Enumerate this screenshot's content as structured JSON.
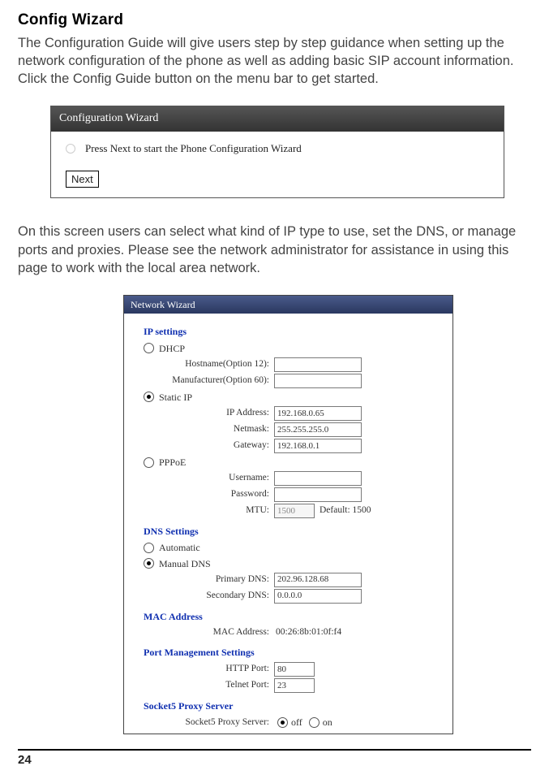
{
  "title": "Config Wizard",
  "intro": "The Configuration Guide will give users step by step guidance when setting up the network configuration of the phone as well as adding basic SIP account information.  Click the Config Guide button on the menu bar to get started.",
  "win1": {
    "title": "Configuration Wizard",
    "prompt": "Press Next to start the Phone Configuration Wizard",
    "next": "Next"
  },
  "mid": "On this screen users can select what kind of IP type to use, set the DNS, or manage ports and proxies.  Please see the network administrator for assistance in using this page to work with the local area network.",
  "win2": {
    "title": "Network Wizard",
    "ip": {
      "head": "IP settings",
      "dhcp": "DHCP",
      "hostname_label": "Hostname(Option 12):",
      "hostname_value": "",
      "manufacturer_label": "Manufacturer(Option 60):",
      "manufacturer_value": "",
      "static": "Static IP",
      "ipaddr_label": "IP Address:",
      "ipaddr_value": "192.168.0.65",
      "netmask_label": "Netmask:",
      "netmask_value": "255.255.255.0",
      "gateway_label": "Gateway:",
      "gateway_value": "192.168.0.1",
      "pppoe": "PPPoE",
      "user_label": "Username:",
      "user_value": "",
      "pass_label": "Password:",
      "pass_value": "",
      "mtu_label": "MTU:",
      "mtu_value": "1500",
      "mtu_default": "Default: 1500"
    },
    "dns": {
      "head": "DNS Settings",
      "auto": "Automatic",
      "manual": "Manual DNS",
      "primary_label": "Primary DNS:",
      "primary_value": "202.96.128.68",
      "secondary_label": "Secondary DNS:",
      "secondary_value": "0.0.0.0"
    },
    "mac": {
      "head": "MAC Address",
      "label": "MAC Address:",
      "value": "00:26:8b:01:0f:f4"
    },
    "port": {
      "head": "Port Management Settings",
      "http_label": "HTTP Port:",
      "http_value": "80",
      "telnet_label": "Telnet Port:",
      "telnet_value": "23"
    },
    "proxy": {
      "head": "Socket5 Proxy Server",
      "label": "Socket5 Proxy Server:",
      "off": "off",
      "on": "on"
    }
  },
  "page_number": "24"
}
